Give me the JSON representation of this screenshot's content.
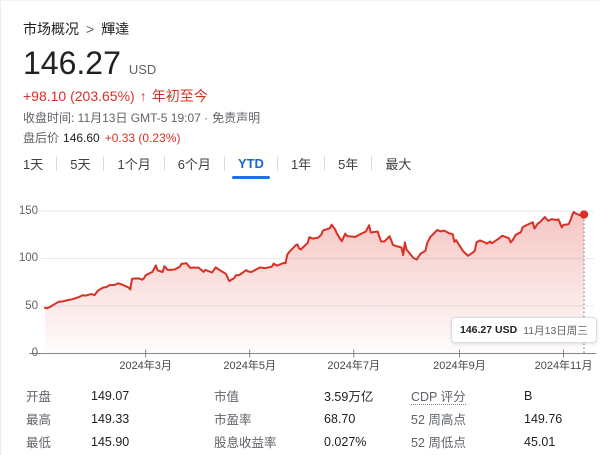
{
  "colors": {
    "positive_red": "#d93025",
    "tab_active_blue": "#1a73e8",
    "axis_gray": "#80868b",
    "grid_gray": "#e8eaed",
    "text_dark": "#202124",
    "text_gray": "#5f6368"
  },
  "header": {
    "breadcrumb": {
      "root": "市场概况",
      "separator": ">",
      "current": "輝達"
    },
    "price": "146.27",
    "currency": "USD",
    "change": {
      "amount": "+98.10 (203.65%)",
      "arrow": "↑",
      "period": "年初至今"
    },
    "close_line": "收盘时间: 11月13日 GMT-5 19:07 ·",
    "disclaimer": "免责声明",
    "after_hours": {
      "label": "盘后价",
      "price": "146.60",
      "change": "+0.33 (0.23%)"
    }
  },
  "tabs": {
    "items": [
      {
        "label": "1天",
        "active": false
      },
      {
        "label": "5天",
        "active": false
      },
      {
        "label": "1个月",
        "active": false
      },
      {
        "label": "6个月",
        "active": false
      },
      {
        "label": "YTD",
        "active": true
      },
      {
        "label": "1年",
        "active": false
      },
      {
        "label": "5年",
        "active": false
      },
      {
        "label": "最大",
        "active": false
      }
    ]
  },
  "tooltip": {
    "price": "146.27 USD",
    "date": "11月13日周三"
  },
  "stats": {
    "columns": [
      {
        "rows": [
          {
            "label": "开盘",
            "value": "149.07"
          },
          {
            "label": "最高",
            "value": "149.33"
          },
          {
            "label": "最低",
            "value": "145.90"
          }
        ]
      },
      {
        "rows": [
          {
            "label": "市值",
            "value": "3.59万亿"
          },
          {
            "label": "市盈率",
            "value": "68.70"
          },
          {
            "label": "股息收益率",
            "value": "0.027%"
          }
        ]
      },
      {
        "rows": [
          {
            "label": "CDP 评分",
            "value": "B",
            "term": true
          },
          {
            "label": "52 周高点",
            "value": "149.76"
          },
          {
            "label": "52 周低点",
            "value": "45.01"
          }
        ]
      }
    ]
  },
  "chart_data": {
    "type": "area",
    "unit": "USD",
    "period": "年初至今",
    "y_ticks": [
      0,
      50,
      100,
      150
    ],
    "ylim": [
      0,
      160
    ],
    "x_ticks": [
      {
        "label": "2024年3月",
        "month": 3
      },
      {
        "label": "2024年5月",
        "month": 5
      },
      {
        "label": "2024年7月",
        "month": 7
      },
      {
        "label": "2024年9月",
        "month": 9
      },
      {
        "label": "2024年11月",
        "month": 11
      }
    ],
    "last_point": {
      "date": "11月13日周三",
      "value": 146.27
    },
    "points": [
      [
        1,
        2,
        48.2
      ],
      [
        1,
        3,
        47.6
      ],
      [
        1,
        5,
        49.1
      ],
      [
        1,
        8,
        52.3
      ],
      [
        1,
        10,
        54.4
      ],
      [
        1,
        12,
        54.7
      ],
      [
        1,
        16,
        56.4
      ],
      [
        1,
        18,
        57.1
      ],
      [
        1,
        22,
        59.6
      ],
      [
        1,
        24,
        61.3
      ],
      [
        1,
        26,
        61.0
      ],
      [
        1,
        29,
        62.5
      ],
      [
        1,
        31,
        61.5
      ],
      [
        2,
        2,
        66.2
      ],
      [
        2,
        5,
        69.4
      ],
      [
        2,
        7,
        70.0
      ],
      [
        2,
        9,
        72.1
      ],
      [
        2,
        12,
        72.2
      ],
      [
        2,
        14,
        73.9
      ],
      [
        2,
        16,
        72.6
      ],
      [
        2,
        20,
        69.5
      ],
      [
        2,
        21,
        67.4
      ],
      [
        2,
        22,
        78.5
      ],
      [
        2,
        23,
        78.8
      ],
      [
        2,
        26,
        79.0
      ],
      [
        2,
        28,
        77.7
      ],
      [
        2,
        29,
        79.1
      ],
      [
        3,
        1,
        82.3
      ],
      [
        3,
        4,
        85.2
      ],
      [
        3,
        5,
        86.0
      ],
      [
        3,
        7,
        92.7
      ],
      [
        3,
        8,
        87.5
      ],
      [
        3,
        11,
        85.8
      ],
      [
        3,
        12,
        91.9
      ],
      [
        3,
        14,
        87.9
      ],
      [
        3,
        18,
        88.4
      ],
      [
        3,
        21,
        91.4
      ],
      [
        3,
        22,
        94.3
      ],
      [
        3,
        25,
        95.0
      ],
      [
        3,
        27,
        90.2
      ],
      [
        3,
        28,
        90.4
      ],
      [
        4,
        1,
        90.4
      ],
      [
        4,
        4,
        85.9
      ],
      [
        4,
        5,
        88.0
      ],
      [
        4,
        9,
        85.3
      ],
      [
        4,
        11,
        90.6
      ],
      [
        4,
        15,
        86.0
      ],
      [
        4,
        17,
        84.0
      ],
      [
        4,
        19,
        76.2
      ],
      [
        4,
        22,
        79.5
      ],
      [
        4,
        23,
        82.4
      ],
      [
        4,
        25,
        82.6
      ],
      [
        4,
        29,
        87.8
      ],
      [
        4,
        30,
        86.4
      ],
      [
        5,
        2,
        85.8
      ],
      [
        5,
        7,
        90.5
      ],
      [
        5,
        10,
        89.9
      ],
      [
        5,
        14,
        91.4
      ],
      [
        5,
        15,
        94.6
      ],
      [
        5,
        17,
        92.5
      ],
      [
        5,
        21,
        95.4
      ],
      [
        5,
        22,
        94.9
      ],
      [
        5,
        23,
        103.8
      ],
      [
        5,
        24,
        106.5
      ],
      [
        5,
        28,
        113.9
      ],
      [
        5,
        29,
        114.8
      ],
      [
        5,
        30,
        110.5
      ],
      [
        5,
        31,
        109.6
      ],
      [
        6,
        4,
        116.4
      ],
      [
        6,
        5,
        122.4
      ],
      [
        6,
        7,
        120.9
      ],
      [
        6,
        10,
        121.8
      ],
      [
        6,
        12,
        125.2
      ],
      [
        6,
        13,
        129.6
      ],
      [
        6,
        17,
        131.9
      ],
      [
        6,
        18,
        135.6
      ],
      [
        6,
        20,
        130.8
      ],
      [
        6,
        21,
        126.6
      ],
      [
        6,
        24,
        118.1
      ],
      [
        6,
        26,
        126.1
      ],
      [
        6,
        27,
        123.9
      ],
      [
        6,
        28,
        123.5
      ],
      [
        7,
        2,
        122.7
      ],
      [
        7,
        5,
        125.8
      ],
      [
        7,
        8,
        128.2
      ],
      [
        7,
        10,
        134.9
      ],
      [
        7,
        11,
        127.4
      ],
      [
        7,
        15,
        128.4
      ],
      [
        7,
        17,
        118.0
      ],
      [
        7,
        19,
        117.9
      ],
      [
        7,
        22,
        123.5
      ],
      [
        7,
        24,
        114.3
      ],
      [
        7,
        26,
        113.1
      ],
      [
        7,
        29,
        111.6
      ],
      [
        7,
        30,
        103.7
      ],
      [
        7,
        31,
        117.0
      ],
      [
        8,
        1,
        109.2
      ],
      [
        8,
        2,
        107.3
      ],
      [
        8,
        5,
        100.5
      ],
      [
        8,
        7,
        98.9
      ],
      [
        8,
        9,
        104.8
      ],
      [
        8,
        12,
        108.1
      ],
      [
        8,
        13,
        116.1
      ],
      [
        8,
        15,
        122.9
      ],
      [
        8,
        16,
        124.6
      ],
      [
        8,
        19,
        130.0
      ],
      [
        8,
        21,
        128.5
      ],
      [
        8,
        23,
        129.4
      ],
      [
        8,
        26,
        126.5
      ],
      [
        8,
        28,
        125.6
      ],
      [
        8,
        29,
        117.6
      ],
      [
        8,
        30,
        119.4
      ],
      [
        9,
        3,
        108.0
      ],
      [
        9,
        4,
        106.2
      ],
      [
        9,
        6,
        102.8
      ],
      [
        9,
        9,
        106.5
      ],
      [
        9,
        10,
        108.1
      ],
      [
        9,
        11,
        116.9
      ],
      [
        9,
        13,
        119.1
      ],
      [
        9,
        16,
        116.8
      ],
      [
        9,
        17,
        115.6
      ],
      [
        9,
        19,
        117.9
      ],
      [
        9,
        20,
        116.0
      ],
      [
        9,
        24,
        120.9
      ],
      [
        9,
        26,
        124.0
      ],
      [
        9,
        30,
        121.4
      ],
      [
        10,
        1,
        117.0
      ],
      [
        10,
        2,
        118.9
      ],
      [
        10,
        4,
        124.9
      ],
      [
        10,
        7,
        127.7
      ],
      [
        10,
        8,
        132.9
      ],
      [
        10,
        10,
        134.8
      ],
      [
        10,
        14,
        138.1
      ],
      [
        10,
        15,
        131.6
      ],
      [
        10,
        17,
        136.9
      ],
      [
        10,
        18,
        138.0
      ],
      [
        10,
        21,
        143.7
      ],
      [
        10,
        23,
        139.6
      ],
      [
        10,
        25,
        141.5
      ],
      [
        10,
        28,
        140.5
      ],
      [
        10,
        29,
        141.3
      ],
      [
        10,
        31,
        132.8
      ],
      [
        11,
        1,
        135.4
      ],
      [
        11,
        4,
        136.1
      ],
      [
        11,
        5,
        139.9
      ],
      [
        11,
        6,
        145.6
      ],
      [
        11,
        7,
        148.9
      ],
      [
        11,
        8,
        147.6
      ],
      [
        11,
        11,
        145.3
      ],
      [
        11,
        12,
        148.3
      ],
      [
        11,
        13,
        146.27
      ]
    ]
  }
}
